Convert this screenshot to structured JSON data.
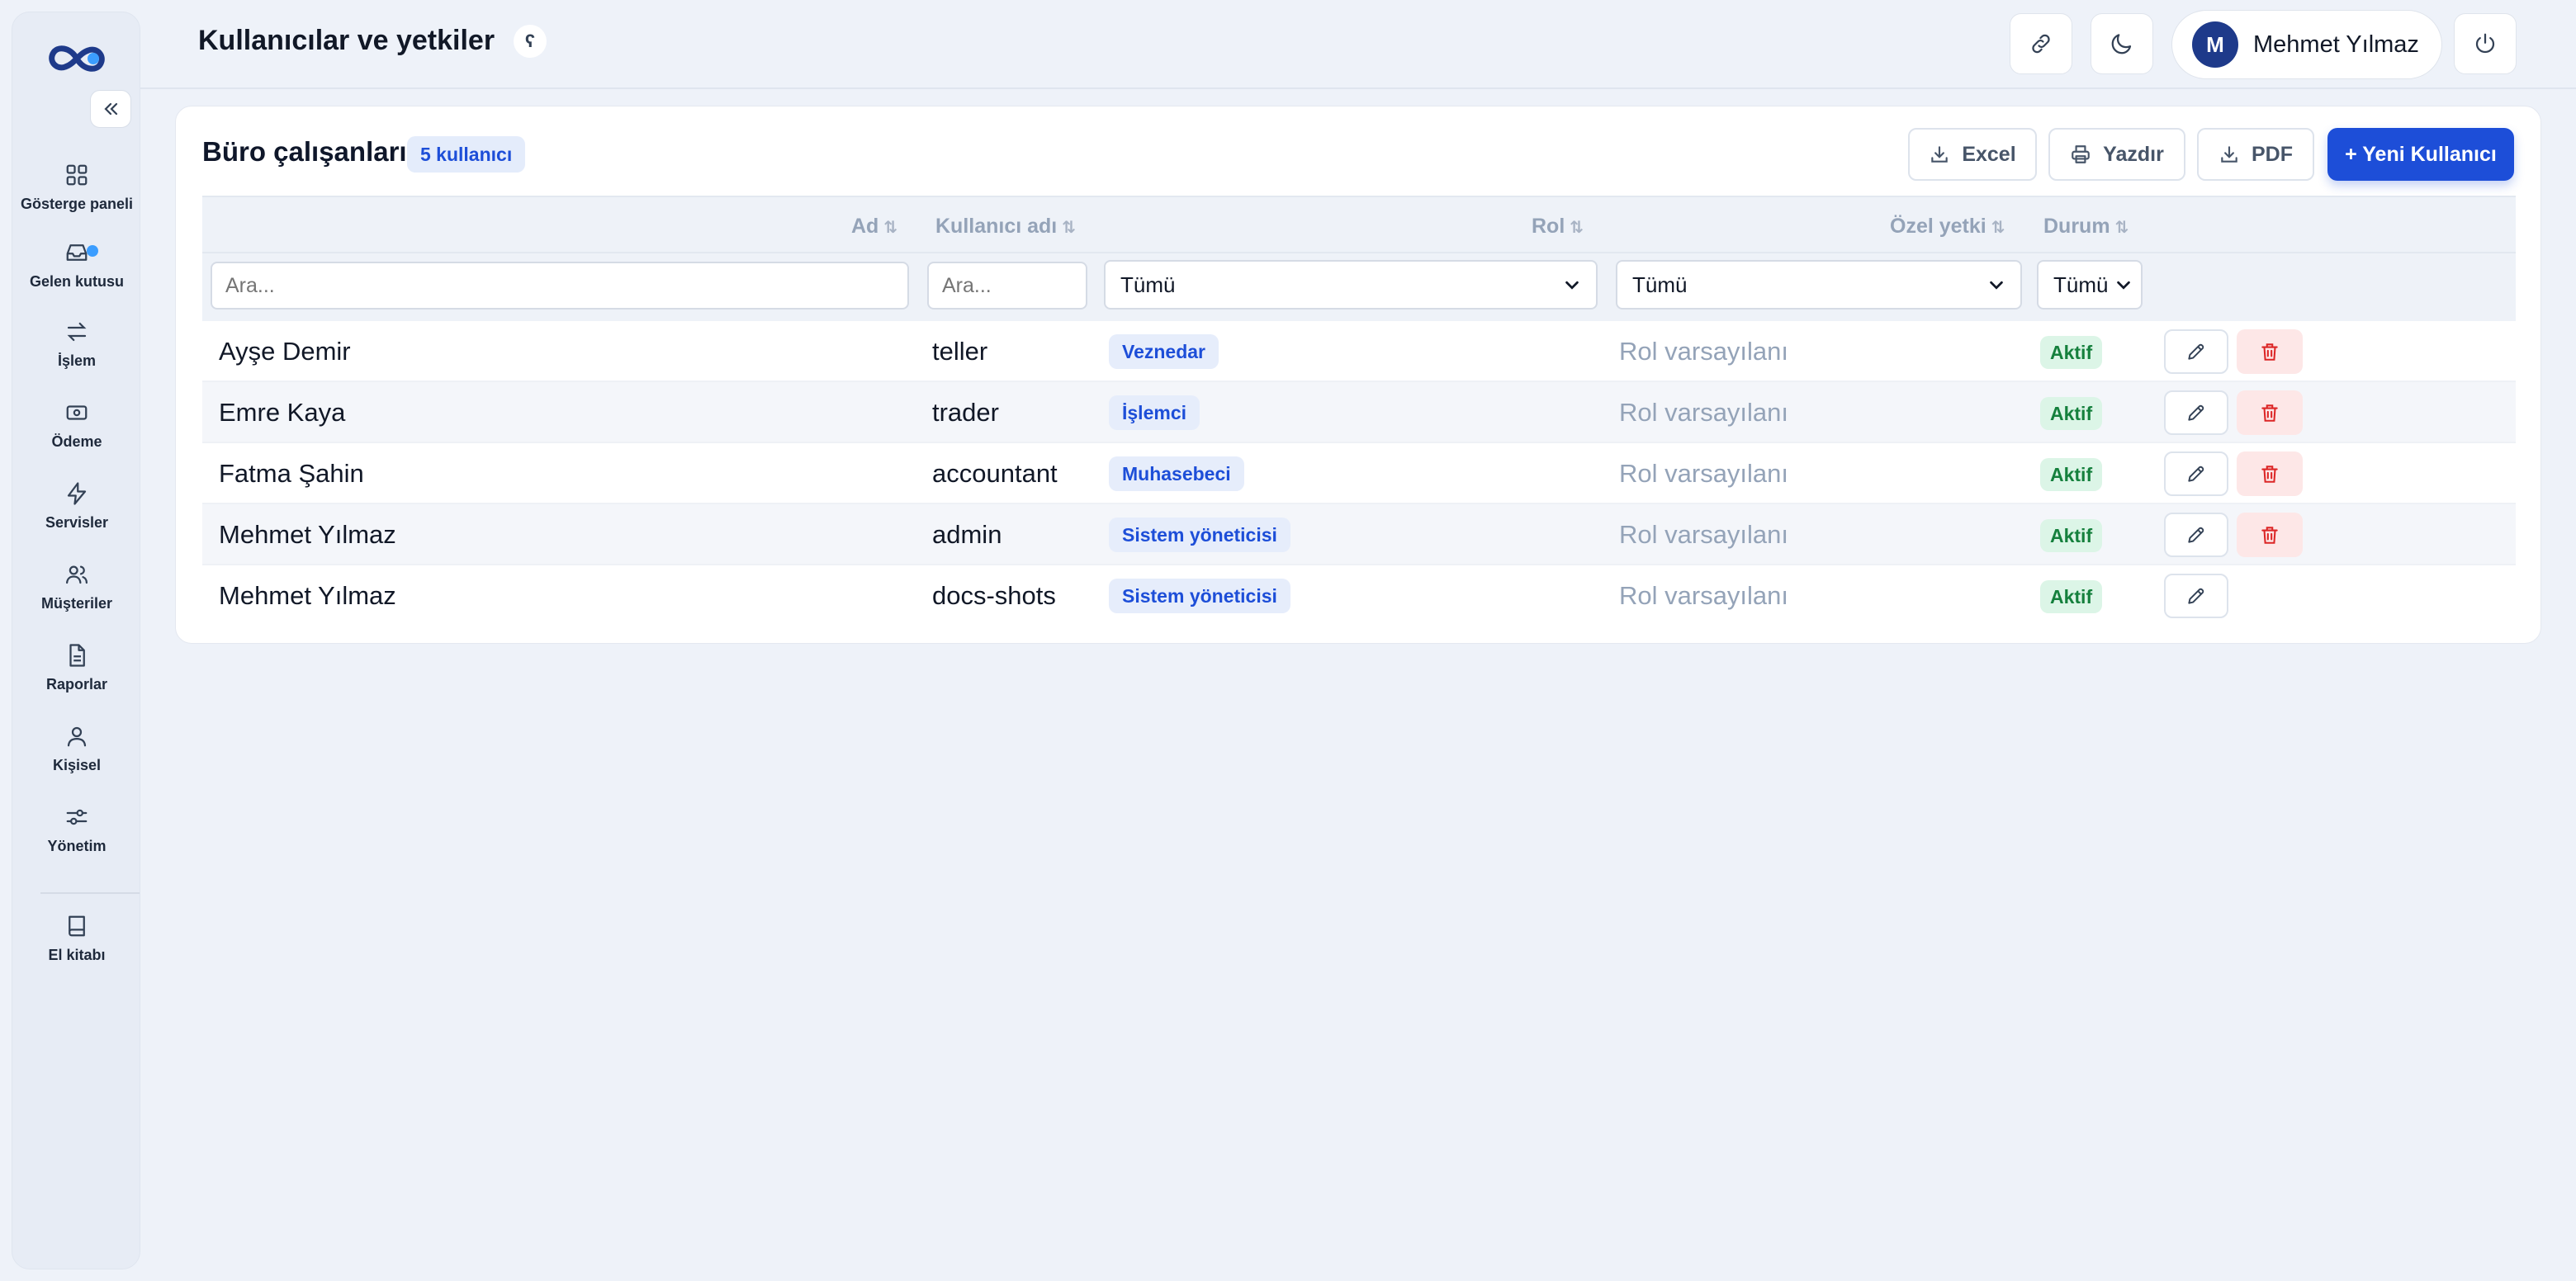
{
  "header": {
    "title": "Kullanıcılar ve yetkiler",
    "help_glyph": "ʕ",
    "user_initial": "M",
    "user_name": "Mehmet Yılmaz"
  },
  "sidebar": {
    "items": [
      {
        "label": "Gösterge paneli",
        "icon": "dashboard-icon"
      },
      {
        "label": "Gelen kutusu",
        "icon": "inbox-icon"
      },
      {
        "label": "İşlem",
        "icon": "transfer-icon"
      },
      {
        "label": "Ödeme",
        "icon": "payment-icon"
      },
      {
        "label": "Servisler",
        "icon": "lightning-icon"
      },
      {
        "label": "Müşteriler",
        "icon": "users-icon"
      },
      {
        "label": "Raporlar",
        "icon": "report-icon"
      },
      {
        "label": "Kişisel",
        "icon": "user-icon"
      },
      {
        "label": "Yönetim",
        "icon": "sliders-icon"
      },
      {
        "label": "El kitabı",
        "icon": "book-icon"
      }
    ]
  },
  "card": {
    "title": "Büro çalışanları",
    "count": "5 kullanıcı",
    "excel_label": "Excel",
    "print_label": "Yazdır",
    "pdf_label": "PDF",
    "new_user_label": "+ Yeni Kullanıcı"
  },
  "table": {
    "columns": {
      "name": "Ad",
      "username": "Kullanıcı adı",
      "role": "Rol",
      "special_permission": "Özel yetki",
      "status": "Durum"
    },
    "filters": {
      "name_placeholder": "Ara...",
      "username_placeholder": "Ara...",
      "role_value": "Tümü",
      "permission_value": "Tümü",
      "status_value": "Tümü"
    },
    "rows": [
      {
        "name": "Ayşe Demir",
        "username": "teller",
        "role": "Veznedar",
        "permission": "Rol varsayılanı",
        "status": "Aktif"
      },
      {
        "name": "Emre Kaya",
        "username": "trader",
        "role": "İşlemci",
        "permission": "Rol varsayılanı",
        "status": "Aktif"
      },
      {
        "name": "Fatma Şahin",
        "username": "accountant",
        "role": "Muhasebeci",
        "permission": "Rol varsayılanı",
        "status": "Aktif"
      },
      {
        "name": "Mehmet Yılmaz",
        "username": "admin",
        "role": "Sistem yöneticisi",
        "permission": "Rol varsayılanı",
        "status": "Aktif"
      },
      {
        "name": "Mehmet Yılmaz",
        "username": "docs-shots",
        "role": "Sistem yöneticisi",
        "permission": "Rol varsayılanı",
        "status": "Aktif"
      }
    ]
  },
  "colors": {
    "primary": "#1d4ed8",
    "success": "#15803d",
    "danger": "#dc2626"
  }
}
